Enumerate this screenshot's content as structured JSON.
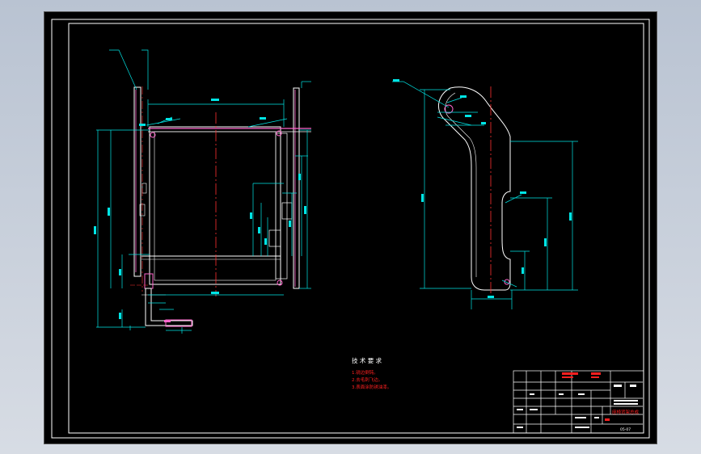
{
  "colors": {
    "background": "#000000",
    "outline": "#ffffff",
    "dimension": "#00e5e5",
    "centerline": "#ff3030",
    "part": "#ff66cc",
    "note_red": "#ff2020"
  },
  "technical_requirements": {
    "title": "技 术 要 求",
    "items": [
      "1.锐边倒钝。",
      "2.去毛刺飞边。",
      "3.表面涂防锈油漆。"
    ]
  },
  "title_block": {
    "drawing_name": "座椅背架总成",
    "drawing_number": "05-07"
  }
}
